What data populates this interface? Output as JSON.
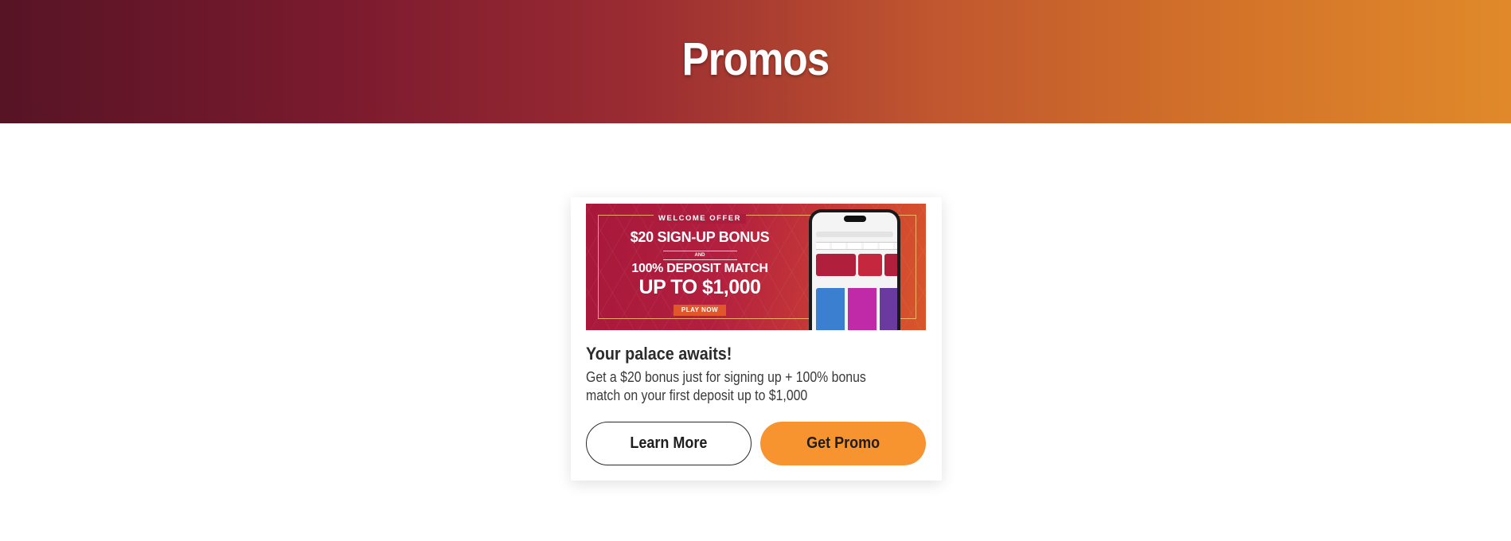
{
  "hero": {
    "title": "Promos"
  },
  "promo_card": {
    "banner": {
      "welcome": "WELCOME OFFER",
      "line1": "$20 SIGN-UP BONUS",
      "and": "AND",
      "line2": "100% DEPOSIT MATCH",
      "line3": "UP TO $1,000",
      "cta": "PLAY NOW"
    },
    "title": "Your palace awaits!",
    "description": "Get a $20 bonus just for signing up + 100% bonus match on your first deposit up to $1,000",
    "learn_more_label": "Learn More",
    "get_promo_label": "Get Promo"
  },
  "colors": {
    "hero_start": "#561425",
    "hero_end": "#e0892a",
    "get_promo_button": "#f79430",
    "banner_red": "#b21f3f"
  }
}
